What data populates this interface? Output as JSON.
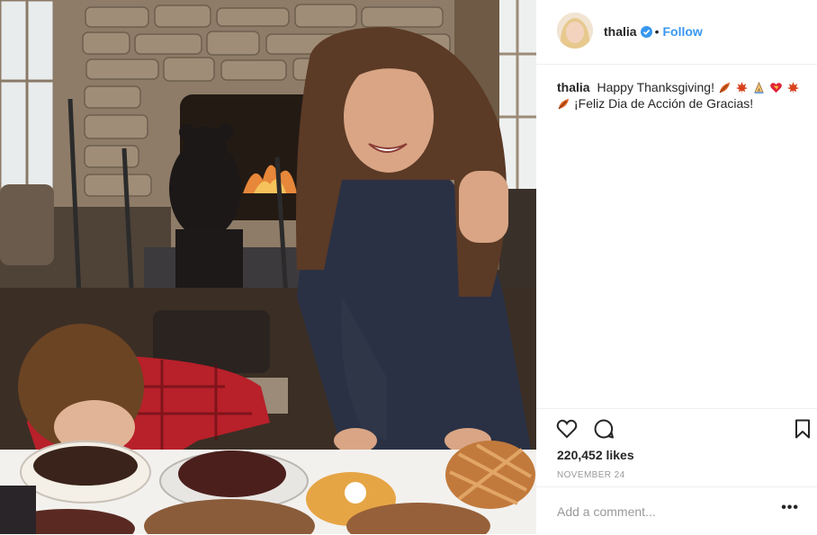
{
  "post": {
    "username": "thalia",
    "follow_label": "Follow",
    "header_separator": "•",
    "caption_line1": "Happy Thanksgiving!",
    "caption_line2": "¡Feliz Dia de Acción de Gracias!",
    "caption_emojis_line1": [
      "autumn-leaf-icon",
      "maple-leaf-icon",
      "praying-hands-icon",
      "heart-icon",
      "maple-leaf-icon"
    ],
    "caption_emojis_line2": [
      "autumn-leaf-icon"
    ],
    "likes": "220,452 likes",
    "date": "NOVEMBER 24",
    "comment_placeholder": "Add a comment...",
    "more_label": "•••"
  },
  "colors": {
    "link": "#3897f0",
    "text": "#262626",
    "muted": "#999999",
    "border": "#efefef"
  }
}
